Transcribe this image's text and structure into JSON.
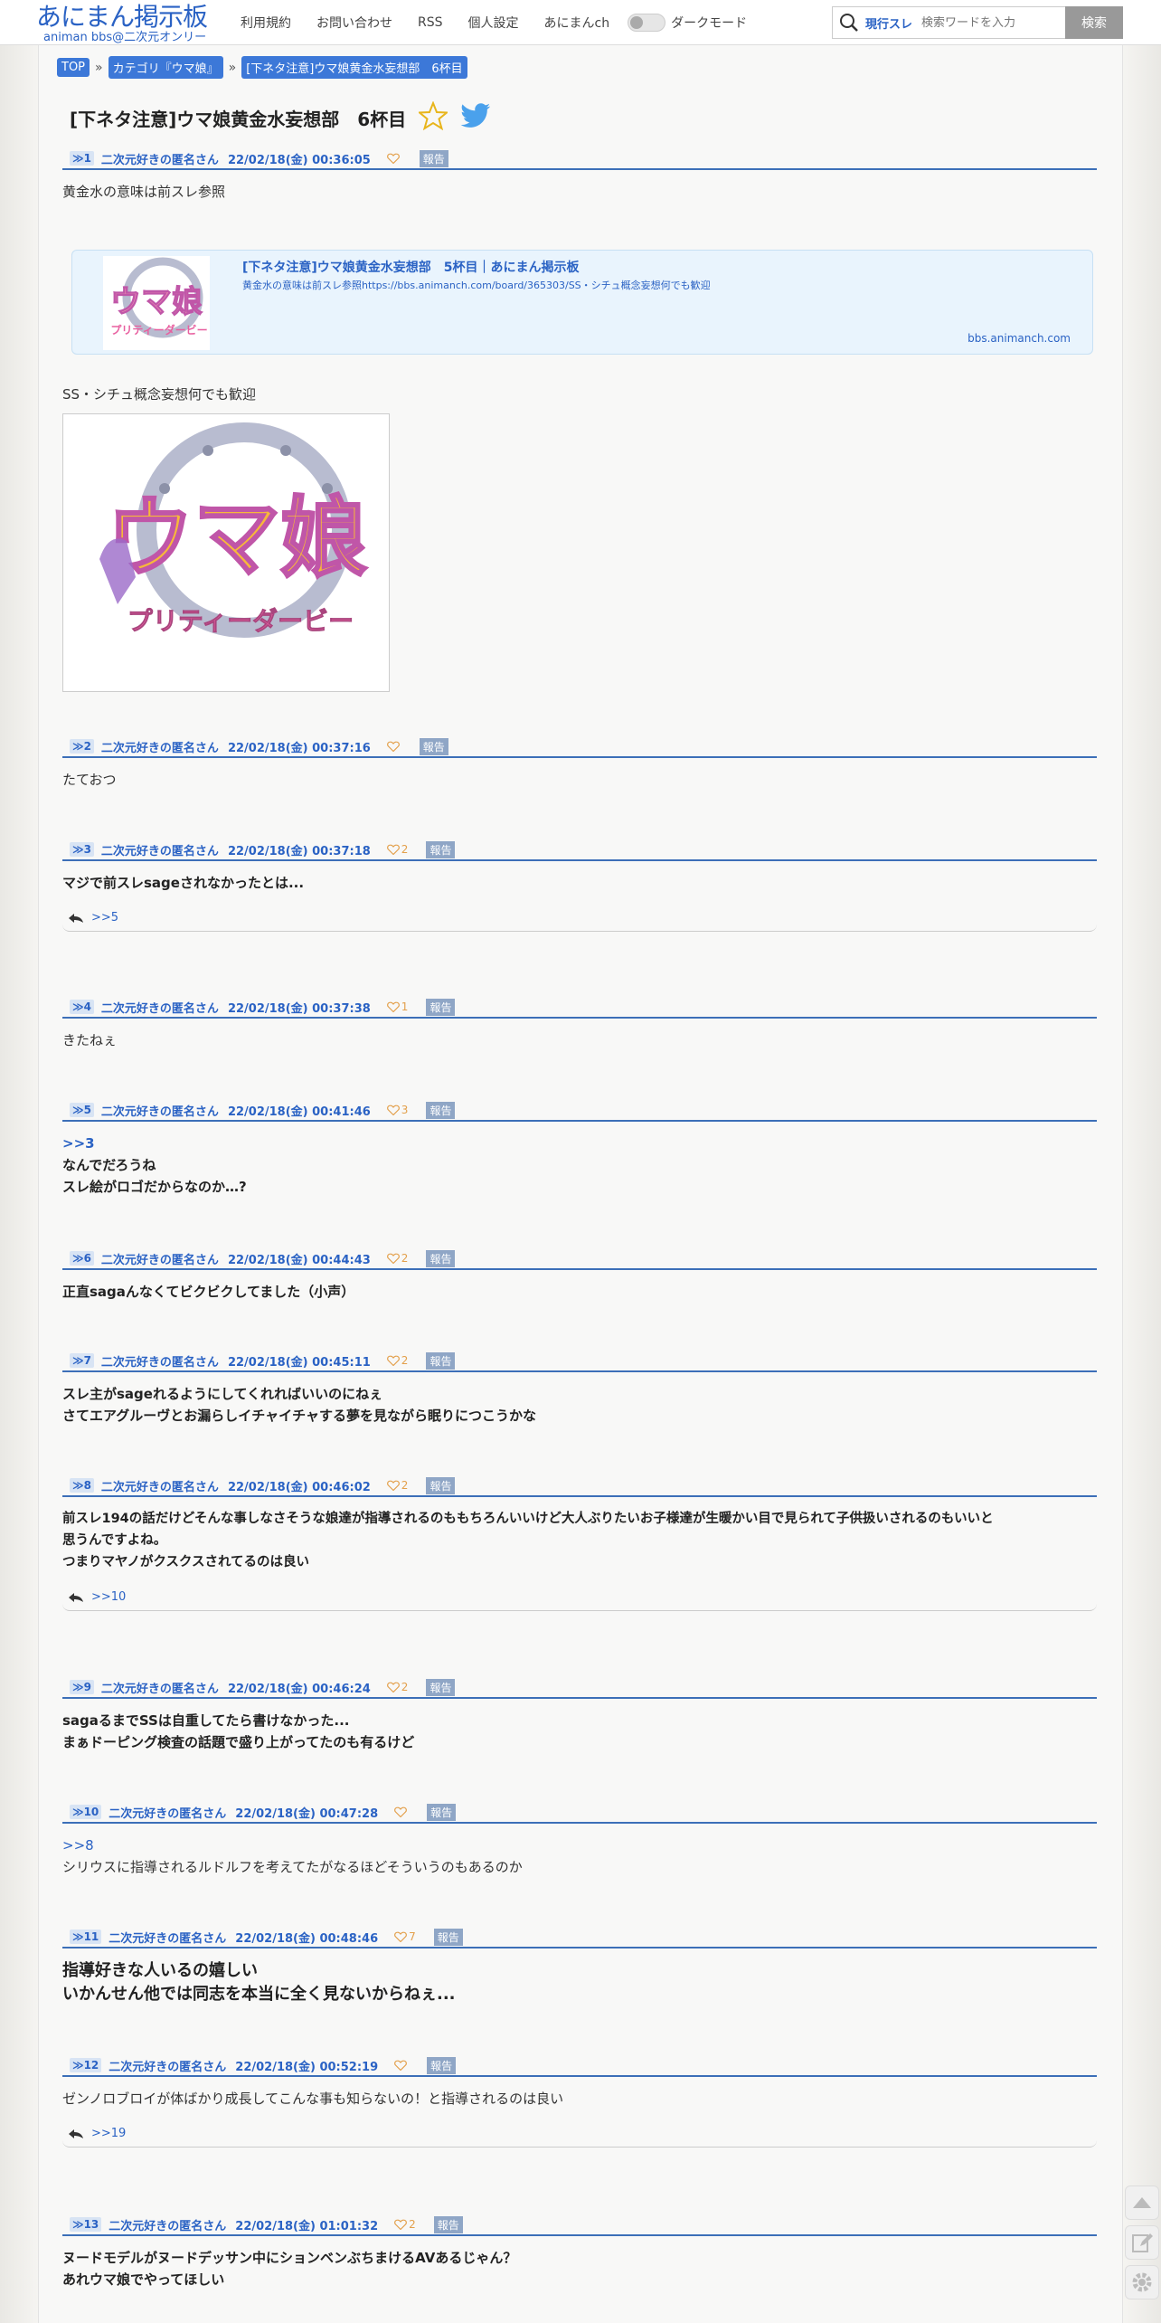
{
  "header": {
    "logo_main": "あにまん掲示板",
    "logo_sub": "animan bbs@二次元オンリー",
    "nav": [
      "利用規約",
      "お問い合わせ",
      "RSS",
      "個人設定",
      "あにまんch"
    ],
    "dark_mode_label": "ダークモード",
    "search_scope": "現行スレ",
    "search_placeholder": "検索ワードを入力",
    "search_button": "検索"
  },
  "breadcrumb": [
    "TOP",
    "カテゴリ『ウマ娘』",
    "[下ネタ注意]ウマ娘黄金水妄想部　6杯目"
  ],
  "breadcrumb_sep": "»",
  "thread_title": "[下ネタ注意]ウマ娘黄金水妄想部　6杯目",
  "report_label": "報告",
  "link_card": {
    "title": "[下ネタ注意]ウマ娘黄金水妄想部　5杯目｜あにまん掲示板",
    "desc": "黄金水の意味は前スレ参照https://bbs.animanch.com/board/365303/SS・シチュ概念妄想何でも歓迎",
    "domain": "bbs.animanch.com"
  },
  "logo_image": {
    "line1": "ウマ娘",
    "line2": "プリティーダービー"
  },
  "posts": [
    {
      "num": "≫1",
      "name": "二次元好きの匿名さん",
      "date": "22/02/18(金) 00:36:05",
      "likes": "",
      "body1": "黄金水の意味は前スレ参照",
      "body2": "SS・シチュ概念妄想何でも歓迎"
    },
    {
      "num": "≫2",
      "name": "二次元好きの匿名さん",
      "date": "22/02/18(金) 00:37:16",
      "likes": "",
      "body": "たておつ"
    },
    {
      "num": "≫3",
      "name": "二次元好きの匿名さん",
      "date": "22/02/18(金) 00:37:18",
      "likes": "2",
      "body": "マジで前スレsageされなかったとは...",
      "reply": ">>5"
    },
    {
      "num": "≫4",
      "name": "二次元好きの匿名さん",
      "date": "22/02/18(金) 00:37:38",
      "likes": "1",
      "body": "きたねぇ"
    },
    {
      "num": "≫5",
      "name": "二次元好きの匿名さん",
      "date": "22/02/18(金) 00:41:46",
      "likes": "3",
      "anchor": ">>3",
      "line1": "なんでだろうね",
      "line2": "スレ絵がロゴだからなのか…?"
    },
    {
      "num": "≫6",
      "name": "二次元好きの匿名さん",
      "date": "22/02/18(金) 00:44:43",
      "likes": "2",
      "body": "正直sagaんなくてビクビクしてました（小声）"
    },
    {
      "num": "≫7",
      "name": "二次元好きの匿名さん",
      "date": "22/02/18(金) 00:45:11",
      "likes": "2",
      "line1": "スレ主がsageれるようにしてくれればいいのにねぇ",
      "line2": "さてエアグルーヴとお漏らしイチャイチャする夢を見ながら眠りにつこうかな"
    },
    {
      "num": "≫8",
      "name": "二次元好きの匿名さん",
      "date": "22/02/18(金) 00:46:02",
      "likes": "2",
      "line1": "前スレ194の話だけどそんな事しなさそうな娘達が指導されるのももちろんいいけど大人ぶりたいお子様達が生暖かい目で見られて子供扱いされるのもいいと",
      "line2": "思うんですよね。",
      "line3": "つまりマヤノがクスクスされてるのは良い",
      "reply": ">>10"
    },
    {
      "num": "≫9",
      "name": "二次元好きの匿名さん",
      "date": "22/02/18(金) 00:46:24",
      "likes": "2",
      "line1": "sagaるまでSSは自重してたら書けなかった...",
      "line2": "まぁドーピング検査の話題で盛り上がってたのも有るけど"
    },
    {
      "num": "≫10",
      "name": "二次元好きの匿名さん",
      "date": "22/02/18(金) 00:47:28",
      "likes": "",
      "anchor": ">>8",
      "body": "シリウスに指導されるルドルフを考えてたがなるほどそういうのもあるのか"
    },
    {
      "num": "≫11",
      "name": "二次元好きの匿名さん",
      "date": "22/02/18(金) 00:48:46",
      "likes": "7",
      "line1": "指導好きな人いるの嬉しい",
      "line2": "いかんせん他では同志を本当に全く見ないからねぇ..."
    },
    {
      "num": "≫12",
      "name": "二次元好きの匿名さん",
      "date": "22/02/18(金) 00:52:19",
      "likes": "",
      "body": "ゼンノロブロイが体ばかり成長してこんな事も知らないの！と指導されるのは良い",
      "reply": ">>19"
    },
    {
      "num": "≫13",
      "name": "二次元好きの匿名さん",
      "date": "22/02/18(金) 01:01:32",
      "likes": "2",
      "line1": "ヌードモデルがヌードデッサン中にションベンぶちまけるAVあるじゃん？",
      "line2": "あれウマ娘でやってほしい"
    }
  ]
}
